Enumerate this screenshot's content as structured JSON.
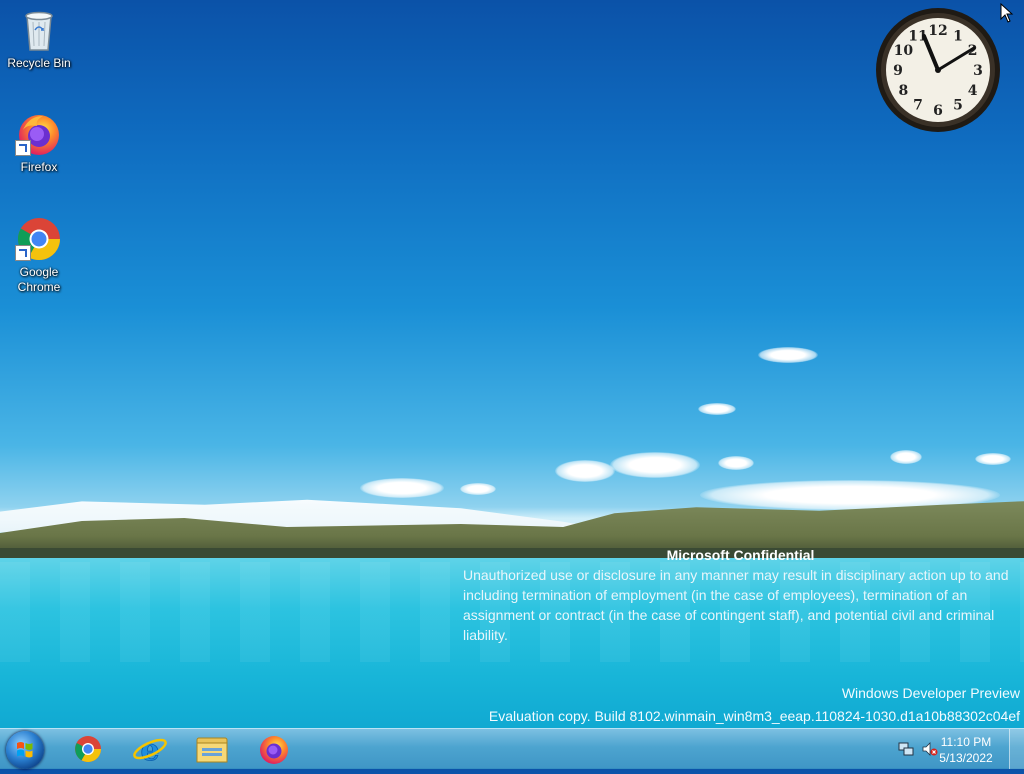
{
  "desktop": {
    "icons": [
      {
        "label": "Recycle Bin",
        "icon": "recycle-bin-icon"
      },
      {
        "label": "Firefox",
        "icon": "firefox-icon"
      },
      {
        "label": "Google Chrome",
        "icon": "chrome-icon"
      }
    ]
  },
  "clock_gadget": {
    "numerals": [
      "12",
      "1",
      "2",
      "3",
      "4",
      "5",
      "6",
      "7",
      "8",
      "9",
      "10",
      "11"
    ]
  },
  "notice": {
    "title": "Microsoft Confidential",
    "body": "Unauthorized use or disclosure in any manner may result in disciplinary action up to and including termination of employment (in the case of employees), termination of an assignment or contract (in the case of contingent staff), and potential civil and criminal liability."
  },
  "watermark": {
    "line1": "Windows Developer Preview",
    "line2": "Evaluation copy. Build 8102.winmain_win8m3_eeap.110824-1030.d1a10b88302c04ef"
  },
  "taskbar": {
    "pinned": [
      "chrome-icon",
      "internet-explorer-icon",
      "file-explorer-icon",
      "firefox-icon"
    ],
    "tray": {
      "time": "11:10 PM",
      "date": "5/13/2022",
      "icons": [
        "network-icon",
        "volume-muted-icon"
      ]
    }
  },
  "colors": {
    "taskbar": "#4aa3d0",
    "sky_top": "#0b52a8",
    "lake": "#18b5d8"
  }
}
